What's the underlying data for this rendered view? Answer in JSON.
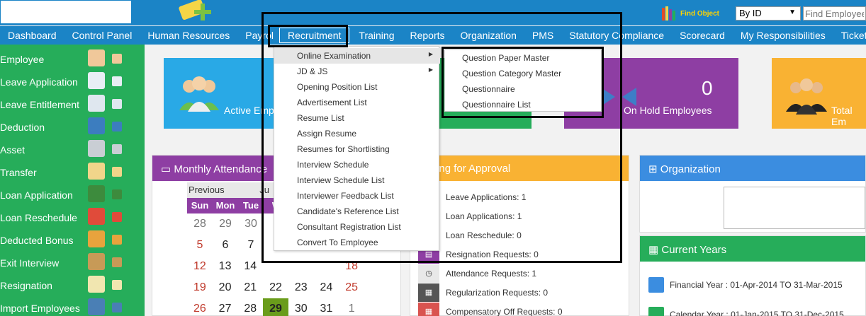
{
  "header": {
    "find_object_label": "Find Object",
    "search_type_value": "By ID",
    "search_placeholder": "Find Employee"
  },
  "nav": {
    "items": [
      "Dashboard",
      "Control Panel",
      "Human Resources",
      "Payrol",
      "Recruitment",
      "Training",
      "Reports",
      "Organization",
      "PMS",
      "Statutory Compliance",
      "Scorecard",
      "My Responsibilities",
      "Ticket"
    ],
    "active": "Recruitment"
  },
  "sidebar": {
    "items": [
      "Employee",
      "Leave Application",
      "Leave Entitlement",
      "Deduction",
      "Asset",
      "Transfer",
      "Loan Application",
      "Loan Reschedule",
      "Deducted Bonus",
      "Exit Interview",
      "Resignation",
      "Import Employees"
    ]
  },
  "tiles": {
    "active_label": "Active Emp",
    "onhold_count": "0",
    "onhold_label": "On Hold Employees",
    "total_label": "Total Em"
  },
  "panels": {
    "attendance_title": "Monthly Attendance",
    "pending_title": "ending for Approval",
    "organization_title": "Organization",
    "current_years_title": "Current Years",
    "financial_year": "Financial Year : 01-Apr-2014 TO 31-Mar-2015",
    "calendar_year": "Calendar Year : 01-Jan-2015 TO 31-Dec-2015"
  },
  "calendar": {
    "prev_label": "Previous",
    "month_label": "Ju",
    "day_headers": [
      "Sun",
      "Mon",
      "Tue",
      "W"
    ],
    "rows": [
      [
        "28",
        "29",
        "30",
        "",
        "",
        "",
        ""
      ],
      [
        "5",
        "6",
        "7",
        "",
        "",
        "",
        ""
      ],
      [
        "12",
        "13",
        "14",
        "",
        "",
        "",
        "18"
      ],
      [
        "19",
        "20",
        "21",
        "22",
        "23",
        "24",
        "25"
      ],
      [
        "26",
        "27",
        "28",
        "29",
        "30",
        "31",
        "1"
      ]
    ],
    "today": "29"
  },
  "pending": {
    "items": [
      "Leave Applications: 1",
      "Loan Applications: 1",
      "Loan Reschedule: 0",
      "Resignation Requests: 0",
      "Attendance Requests: 1",
      "Regularization Requests: 0",
      "Compensatory Off Requests: 0"
    ]
  },
  "recruitment_menu": {
    "items": [
      "Online Examination",
      "JD & JS",
      "Opening Position List",
      "Advertisement List",
      "Resume List",
      "Assign Resume",
      "Resumes for Shortlisting",
      "Interview Schedule",
      "Interview Schedule List",
      "Interviewer Feedback List",
      "Candidate's Reference List",
      "Consultant Registration List",
      "Convert To Employee"
    ]
  },
  "exam_submenu": {
    "items": [
      "Question Paper Master",
      "Question Category Master",
      "Questionnaire",
      "Questionnaire List"
    ]
  },
  "colors": {
    "brand_blue": "#1b84c6",
    "sidebar_green": "#26ad5a",
    "purple": "#8e3ea3",
    "orange": "#f9b233",
    "sky": "#29a9e6"
  }
}
